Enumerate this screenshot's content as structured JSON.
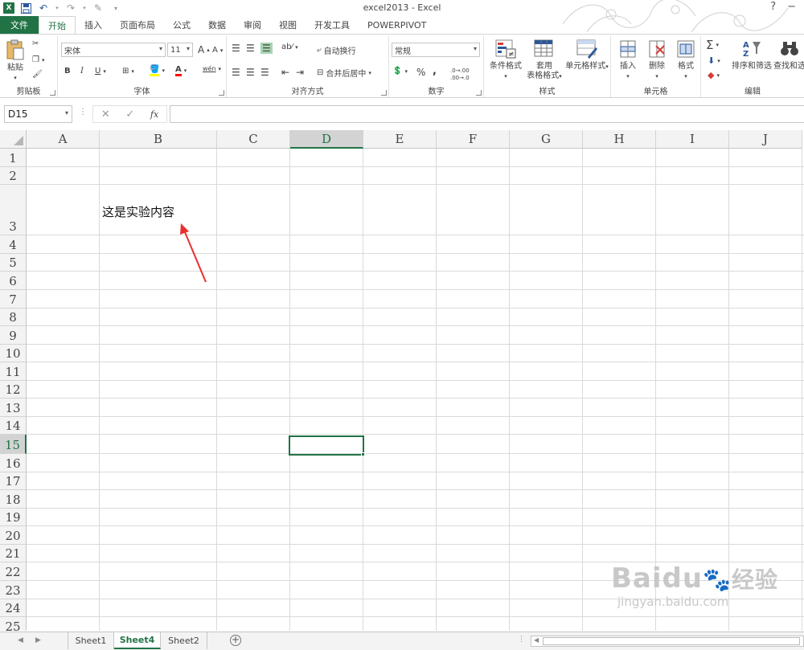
{
  "window": {
    "title": "excel2013 - Excel",
    "help": "?",
    "min": "−"
  },
  "tabs": {
    "file": "文件",
    "items": [
      "开始",
      "插入",
      "页面布局",
      "公式",
      "数据",
      "审阅",
      "视图",
      "开发工具",
      "POWERPIVOT"
    ]
  },
  "ribbon": {
    "clipboard": {
      "paste": "粘贴",
      "label": "剪贴板"
    },
    "font": {
      "name": "宋体",
      "size": "11",
      "grow": "A",
      "shrink": "A",
      "bold": "B",
      "italic": "I",
      "underline": "U",
      "phonetic": "wén",
      "label": "字体"
    },
    "align": {
      "wrap": "自动换行",
      "merge": "合并后居中",
      "label": "对齐方式"
    },
    "number": {
      "format": "常规",
      "percent": "%",
      "comma": ",",
      "inc": ".0→.00",
      "dec": ".00→.0",
      "label": "数字"
    },
    "styles": {
      "cond": "条件格式",
      "table_1": "套用",
      "table_2": "表格格式",
      "cell": "单元格样式",
      "label": "样式"
    },
    "cells": {
      "insert": "插入",
      "delete": "删除",
      "format": "格式",
      "label": "单元格"
    },
    "edit": {
      "sum": "Σ",
      "sort": "排序和筛选",
      "find": "查找和选",
      "label": "编辑"
    }
  },
  "formula_bar": {
    "name_box": "D15",
    "cancel": "✕",
    "enter": "✓",
    "fx": "fx",
    "content": ""
  },
  "grid": {
    "columns": [
      "A",
      "B",
      "C",
      "D",
      "E",
      "F",
      "G",
      "H",
      "I",
      "J"
    ],
    "selected_column": "D",
    "rows": [
      "1",
      "2",
      "3",
      "4",
      "5",
      "6",
      "7",
      "8",
      "9",
      "10",
      "11",
      "12",
      "13",
      "14",
      "15",
      "16",
      "17",
      "18",
      "19",
      "20",
      "21",
      "22",
      "23",
      "24",
      "25"
    ],
    "selected_row": "15",
    "active_cell": "D15",
    "cells": {
      "B3": "这是实验内容"
    }
  },
  "sheets": {
    "tabs": [
      "Sheet1",
      "Sheet4",
      "Sheet2"
    ],
    "active": "Sheet4",
    "add": "+"
  },
  "colors": {
    "accent": "#217346",
    "annotation_arrow": "#e8312f"
  },
  "watermark": {
    "brand": "Baidu",
    "brand_cn": "经验",
    "url": "jingyan.baidu.com"
  }
}
